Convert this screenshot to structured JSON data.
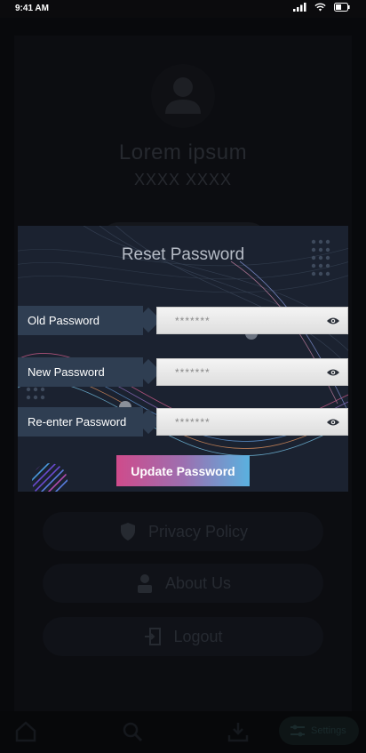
{
  "status_bar": {
    "time": "9:41 AM"
  },
  "profile": {
    "name": "Lorem ipsum",
    "subtitle": "XXXX XXXX"
  },
  "menu": {
    "privacy_label": "Privacy Policy",
    "about_label": "About Us",
    "logout_label": "Logout"
  },
  "bottom_nav": {
    "settings_label": "Settings"
  },
  "modal": {
    "title": "Reset Password",
    "fields": [
      {
        "label": "Old Password",
        "value": "*******"
      },
      {
        "label": "New Password",
        "value": "*******"
      },
      {
        "label": "Re-enter Password",
        "value": "*******"
      }
    ],
    "submit_label": "Update Password"
  },
  "colors": {
    "modal_bg": "#1b2230",
    "label_bg": "#2f3e52",
    "button_gradient_start": "#cf4b8b",
    "button_gradient_end": "#5ab1df"
  }
}
